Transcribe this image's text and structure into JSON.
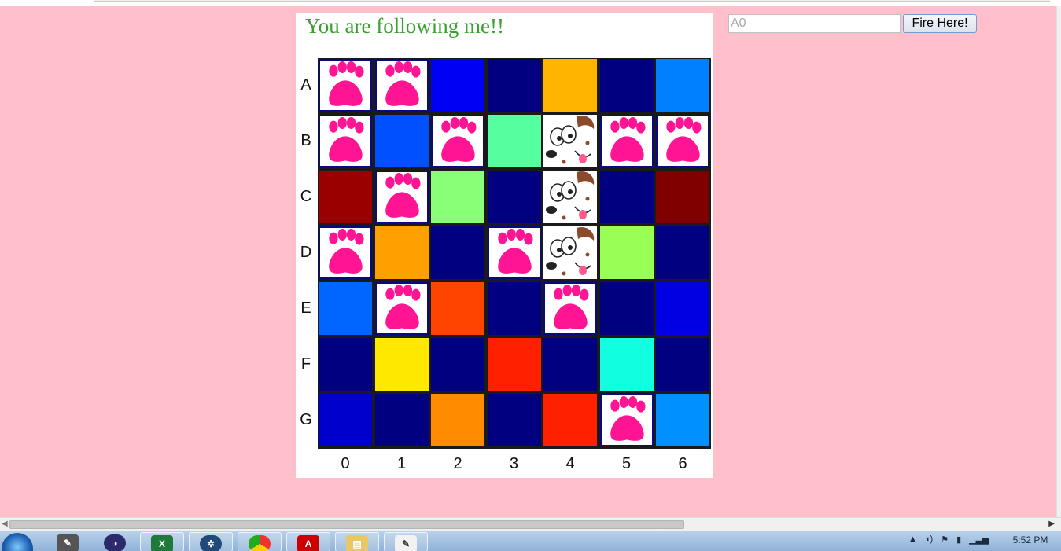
{
  "game": {
    "title": "You are following me!!",
    "rows": [
      "A",
      "B",
      "C",
      "D",
      "E",
      "F",
      "G"
    ],
    "cols": [
      "0",
      "1",
      "2",
      "3",
      "4",
      "5",
      "6"
    ],
    "grid": [
      [
        "paw",
        "paw",
        "#0000f5",
        "#000080",
        "#ffb400",
        "#000080",
        "#0080ff"
      ],
      [
        "paw",
        "#0050ff",
        "paw",
        "#55ffa0",
        "dog",
        "paw",
        "paw"
      ],
      [
        "#9b0000",
        "paw",
        "#88ff77",
        "#000080",
        "dog",
        "#000080",
        "#800000"
      ],
      [
        "paw",
        "#ffa000",
        "#000080",
        "paw",
        "dog",
        "#99ff55",
        "#000080"
      ],
      [
        "#0066ff",
        "paw",
        "#ff4400",
        "#000080",
        "paw",
        "#000080",
        "#0000e0"
      ],
      [
        "#000080",
        "#ffe800",
        "#000080",
        "#ff2000",
        "#000080",
        "#11ffe0",
        "#000080"
      ],
      [
        "#0000cc",
        "#000080",
        "#ff8c00",
        "#000080",
        "#ff2000",
        "paw",
        "#0090ff"
      ]
    ],
    "colors": {
      "title": "#3aa030",
      "paw": "#ff1493",
      "page_background": "#ffc0cb"
    }
  },
  "controls": {
    "coordinate_placeholder": "A0",
    "coordinate_value": "",
    "fire_label": "Fire Here!"
  },
  "taskbar": {
    "time": "5:52 PM",
    "apps": [
      "start-orb",
      "tools-icon",
      "eclipse-icon",
      "excel-icon",
      "network-icon",
      "chrome-icon",
      "acrobat-icon",
      "explorer-icon",
      "notepad-icon"
    ]
  }
}
